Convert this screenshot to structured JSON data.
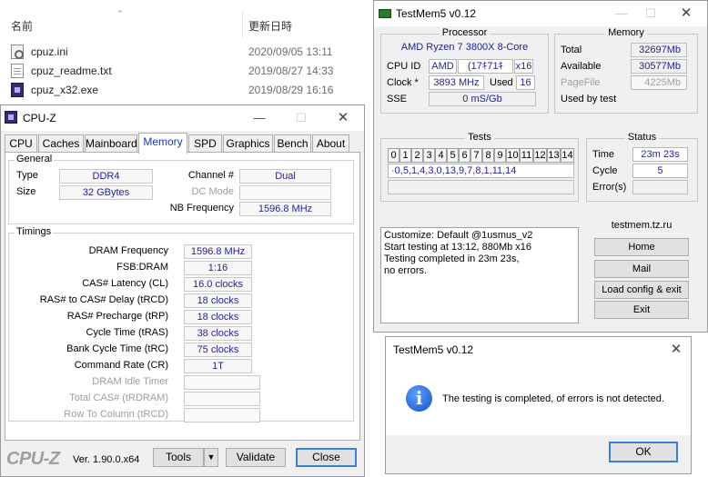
{
  "explorer": {
    "col_name": "名前",
    "col_date": "更新日時",
    "files": [
      {
        "name": "cpuz.ini",
        "date": "2020/09/05 13:11",
        "icon": "config-file-icon"
      },
      {
        "name": "cpuz_readme.txt",
        "date": "2019/08/27 14:33",
        "icon": "text-file-icon"
      },
      {
        "name": "cpuz_x32.exe",
        "date": "2019/08/29 16:16",
        "icon": "cpuz-exe-icon"
      }
    ]
  },
  "cpuz": {
    "title": "CPU-Z",
    "tabs": [
      "CPU",
      "Caches",
      "Mainboard",
      "Memory",
      "SPD",
      "Graphics",
      "Bench",
      "About"
    ],
    "active_tab": "Memory",
    "general": {
      "title": "General",
      "type_label": "Type",
      "type_value": "DDR4",
      "size_label": "Size",
      "size_value": "32 GBytes",
      "channel_label": "Channel #",
      "channel_value": "Dual",
      "dcmode_label": "DC Mode",
      "dcmode_value": "",
      "nbfreq_label": "NB Frequency",
      "nbfreq_value": "1596.8 MHz"
    },
    "timings": {
      "title": "Timings",
      "rows": [
        {
          "label": "DRAM Frequency",
          "value": "1596.8 MHz",
          "dim": false
        },
        {
          "label": "FSB:DRAM",
          "value": "1:16",
          "dim": false
        },
        {
          "label": "CAS# Latency (CL)",
          "value": "16.0 clocks",
          "dim": false
        },
        {
          "label": "RAS# to CAS# Delay (tRCD)",
          "value": "18 clocks",
          "dim": false
        },
        {
          "label": "RAS# Precharge (tRP)",
          "value": "18 clocks",
          "dim": false
        },
        {
          "label": "Cycle Time (tRAS)",
          "value": "38 clocks",
          "dim": false
        },
        {
          "label": "Bank Cycle Time (tRC)",
          "value": "75 clocks",
          "dim": false
        },
        {
          "label": "Command Rate (CR)",
          "value": "1T",
          "dim": false
        },
        {
          "label": "DRAM Idle Timer",
          "value": "",
          "dim": true
        },
        {
          "label": "Total CAS# (tRDRAM)",
          "value": "",
          "dim": true
        },
        {
          "label": "Row To Column (tRCD)",
          "value": "",
          "dim": true
        }
      ]
    },
    "footer": {
      "brand": "CPU-Z",
      "version": "Ver. 1.90.0.x64",
      "tools_label": "Tools",
      "validate_label": "Validate",
      "close_label": "Close"
    }
  },
  "testmem": {
    "title": "TestMem5 v0.12",
    "processor": {
      "title": "Processor",
      "name": "AMD Ryzen 7 3800X 8-Core",
      "cpuid_label": "CPU ID",
      "cpuid_vendor": "AMD",
      "cpuid_sig": "(17ｷ71ｷ",
      "cpuid_threads": "x16",
      "clock_label": "Clock *",
      "clock_value": "3893 MHz",
      "used_label": "Used",
      "used_value": "16",
      "sse_label": "SSE",
      "sse_value": "0 mS/Gb"
    },
    "memory": {
      "title": "Memory",
      "total_label": "Total",
      "total_value": "32697Mb",
      "available_label": "Available",
      "available_value": "30577Mb",
      "pagefile_label": "PageFile",
      "pagefile_value": "4225Mb",
      "usedby_label": "Used by test"
    },
    "tests": {
      "title": "Tests",
      "numbers": [
        "0",
        "1",
        "2",
        "3",
        "4",
        "5",
        "6",
        "7",
        "8",
        "9",
        "10",
        "11",
        "12",
        "13",
        "14"
      ],
      "sequence": "·0,5,1,4,3,0,13,9,7,8,1,11,14"
    },
    "status": {
      "title": "Status",
      "time_label": "Time",
      "time_value": "23m 23s",
      "cycle_label": "Cycle",
      "cycle_value": "5",
      "errors_label": "Error(s)",
      "errors_value": ""
    },
    "log": [
      "Customize: Default @1usmus_v2",
      "Start testing at 13:12, 880Mb x16",
      "Testing completed in 23m 23s,",
      "no errors."
    ],
    "site": "testmem.tz.ru",
    "buttons": [
      "Home",
      "Mail",
      "Load config & exit",
      "Exit"
    ]
  },
  "dialog": {
    "title": "TestMem5 v0.12",
    "message": "The testing is completed, of errors is not detected.",
    "ok_label": "OK"
  },
  "window_controls": {
    "minimize": "—",
    "maximize": "☐",
    "close": "✕"
  }
}
